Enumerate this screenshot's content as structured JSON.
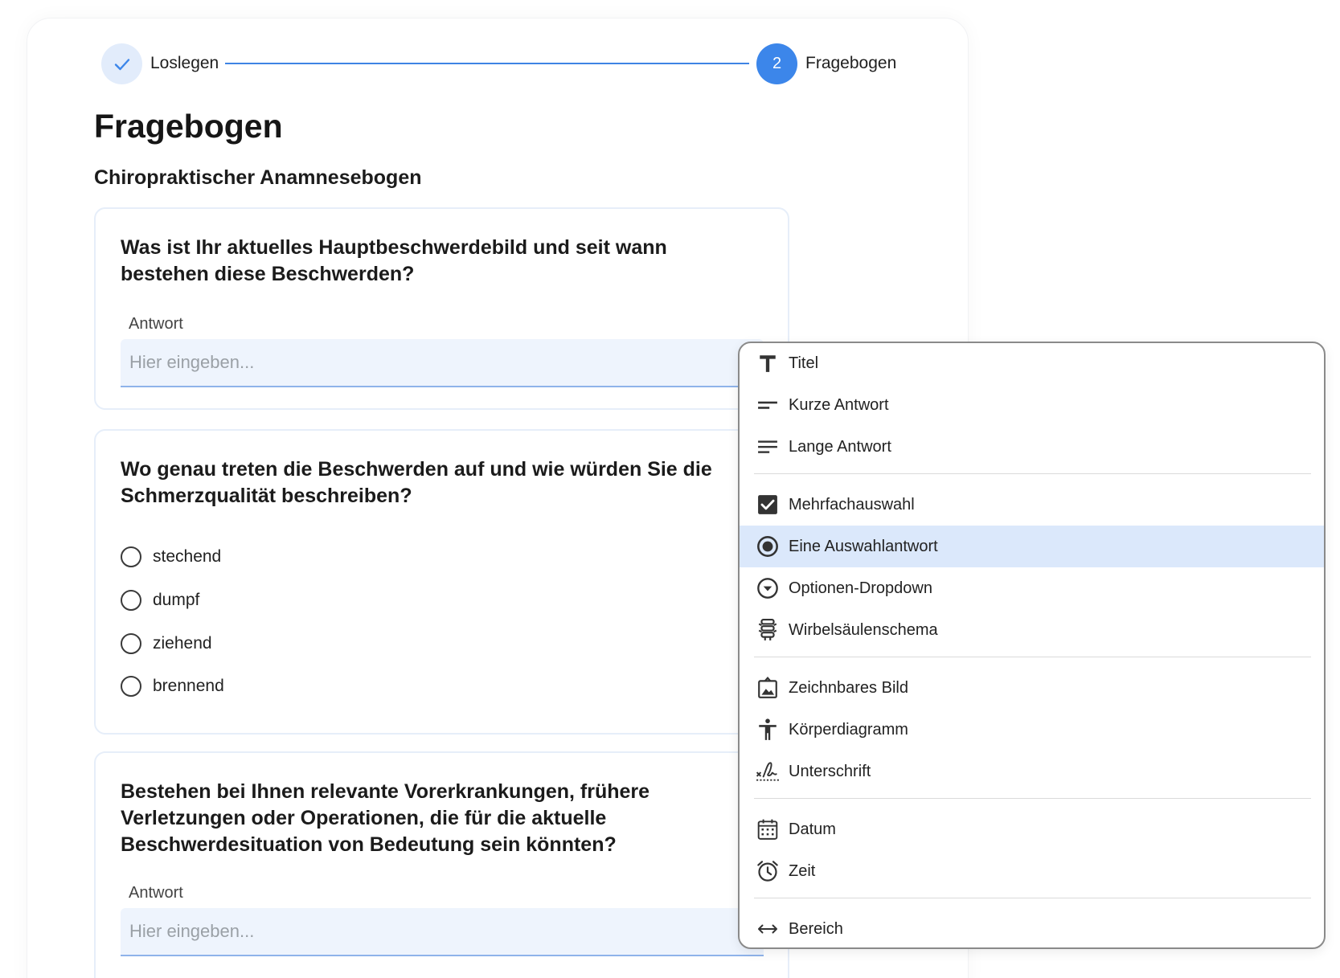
{
  "stepper": {
    "step1_label": "Loslegen",
    "step2_number": "2",
    "step2_label": "Fragebogen"
  },
  "page": {
    "title": "Fragebogen",
    "form_title": "Chiropraktischer Anamnesebogen"
  },
  "questions": [
    {
      "text": "Was ist Ihr aktuelles Hauptbeschwerdebild und seit wann bestehen diese Beschwerden?",
      "answer_label": "Antwort",
      "placeholder": "Hier eingeben..."
    },
    {
      "text": "Wo genau treten die Beschwerden auf und wie würden Sie die Schmerzqualität beschreiben?",
      "options": [
        "stechend",
        "dumpf",
        "ziehend",
        "brennend"
      ]
    },
    {
      "text": "Bestehen bei Ihnen relevante Vorerkrankungen, frühere Verletzungen oder Operationen, die für die aktuelle Beschwerdesituation von Bedeutung sein könnten?",
      "answer_label": "Antwort",
      "placeholder": "Hier eingeben..."
    }
  ],
  "menu": {
    "selected": "Eine Auswahlantwort",
    "items": [
      {
        "label": "Titel",
        "icon": "title-icon"
      },
      {
        "label": "Kurze Antwort",
        "icon": "short-answer-icon"
      },
      {
        "label": "Lange Antwort",
        "icon": "long-answer-icon"
      },
      {
        "label": "Mehrfachauswahl",
        "icon": "checkbox-icon"
      },
      {
        "label": "Eine Auswahlantwort",
        "icon": "radio-button-icon"
      },
      {
        "label": "Optionen-Dropdown",
        "icon": "dropdown-icon"
      },
      {
        "label": "Wirbelsäulenschema",
        "icon": "spine-icon"
      },
      {
        "label": "Zeichnbares Bild",
        "icon": "drawable-image-icon"
      },
      {
        "label": "Körperdiagramm",
        "icon": "body-diagram-icon"
      },
      {
        "label": "Unterschrift",
        "icon": "signature-icon"
      },
      {
        "label": "Datum",
        "icon": "calendar-icon"
      },
      {
        "label": "Zeit",
        "icon": "alarm-clock-icon"
      },
      {
        "label": "Bereich",
        "icon": "range-arrows-icon"
      }
    ]
  },
  "colors": {
    "accent": "#3c86ea",
    "accent_light": "#e2ecfb",
    "input_bg": "#eef4fd",
    "selected_bg": "#dbe8fb"
  }
}
